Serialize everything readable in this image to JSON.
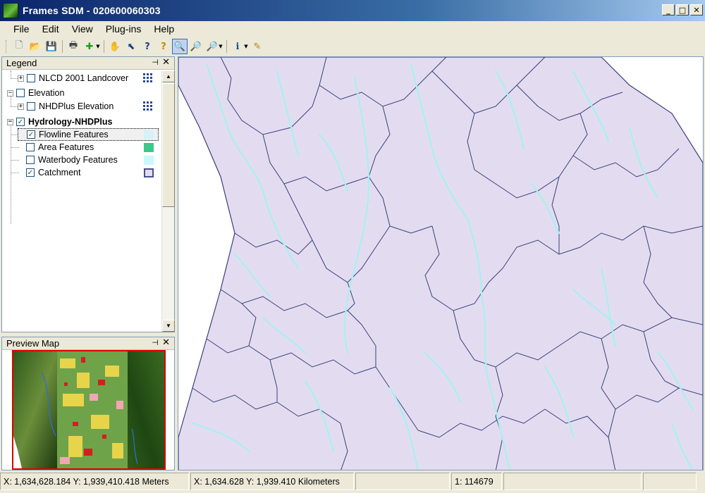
{
  "window": {
    "title": "Frames SDM  - 020600060303",
    "controls": {
      "minimize": "_",
      "maximize": "□",
      "close": "✕"
    }
  },
  "menu": [
    "File",
    "Edit",
    "View",
    "Plug-ins",
    "Help"
  ],
  "toolbar": {
    "buttons": [
      {
        "icon": "new-document-icon",
        "glyph": "🗋"
      },
      {
        "icon": "open-folder-icon",
        "glyph": "📂"
      },
      {
        "icon": "save-icon",
        "glyph": "💾"
      },
      {
        "icon": "print-icon",
        "glyph": "🖶"
      },
      {
        "icon": "add-layer-icon",
        "glyph": "✚"
      },
      {
        "icon": "pan-hand-icon",
        "glyph": "✋"
      },
      {
        "icon": "select-arrow-icon",
        "glyph": "⬉"
      },
      {
        "icon": "identify-help-icon",
        "glyph": "?"
      },
      {
        "icon": "query-help-icon",
        "glyph": "?"
      },
      {
        "icon": "zoom-in-icon",
        "glyph": "🔍"
      },
      {
        "icon": "zoom-out-icon",
        "glyph": "🔎"
      },
      {
        "icon": "zoom-extent-icon",
        "glyph": "🔎"
      },
      {
        "icon": "info-icon",
        "glyph": "i"
      },
      {
        "icon": "notes-icon",
        "glyph": "✎"
      }
    ]
  },
  "legend": {
    "title": "Legend",
    "pin": "⊣",
    "close": "✕",
    "items": [
      {
        "label": "NLCD 2001 Landcover",
        "level": 1,
        "expander": "+",
        "checked": false
      },
      {
        "label": "Elevation",
        "level": 0,
        "expander": "−",
        "checked": false
      },
      {
        "label": "NHDPlus Elevation",
        "level": 1,
        "expander": "+",
        "checked": false
      },
      {
        "label": "Hydrology-NHDPlus",
        "level": 0,
        "expander": "−",
        "checked": true
      },
      {
        "label": "Flowline Features",
        "level": 1,
        "checked": true,
        "selected": true
      },
      {
        "label": "Area Features",
        "level": 1,
        "checked": false
      },
      {
        "label": "Waterbody Features",
        "level": 1,
        "checked": false
      },
      {
        "label": "Catchment",
        "level": 1,
        "checked": true
      }
    ],
    "swatch_colors": {
      "flowline": "#d6f2f6",
      "area": "#3cc88a",
      "waterbody": "#c8fafa",
      "catchment": "#e3dcf0"
    }
  },
  "preview": {
    "title": "Preview Map",
    "pin": "⊣",
    "close": "✕"
  },
  "map": {
    "catchment_fill": "#e3dcf0",
    "boundary_color": "#3a3f7a",
    "stream_color": "#a8f0f0"
  },
  "status": {
    "meters": "X: 1,634,628.184 Y: 1,939,410.418 Meters",
    "kilometers": "X: 1,634.628 Y: 1,939.410 Kilometers",
    "scale": "1: 114679"
  }
}
